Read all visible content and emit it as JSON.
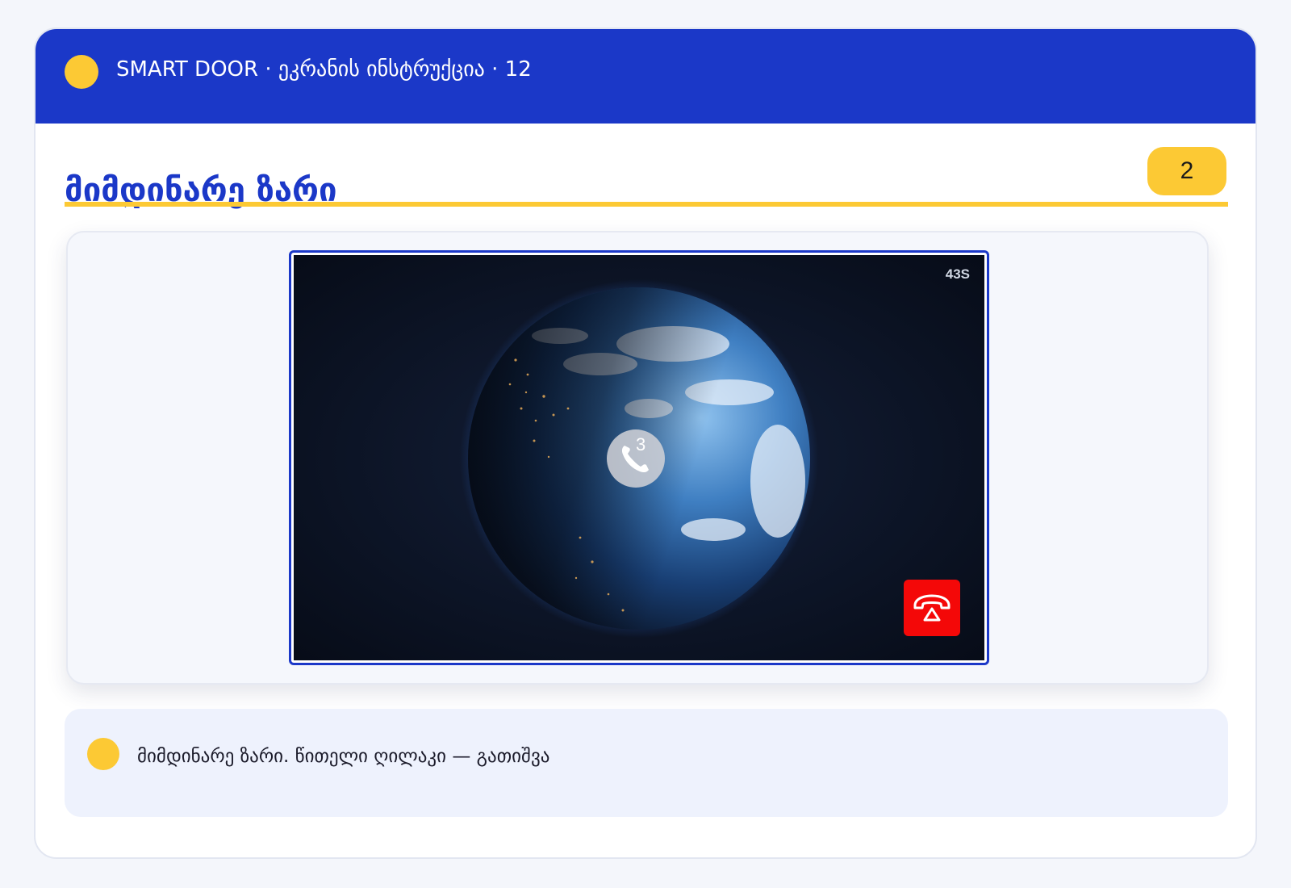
{
  "header": {
    "title": "SMART DOOR · ეკრანის ინსტრუქცია · 12"
  },
  "section": {
    "title": "მიმდინარე ზარი",
    "step_number": "2"
  },
  "screen": {
    "timer": "43S",
    "call_count": "3",
    "icons": [
      "earth-image",
      "phone-call-icon",
      "hangup-phone-icon"
    ],
    "hangup_color": "#f40808"
  },
  "note": {
    "text": "მიმდინარე ზარი. წითელი ღილაკი — გათიშვა"
  },
  "colors": {
    "brand_blue": "#1b38c8",
    "accent_yellow": "#fcc934",
    "background": "#f4f6fb"
  }
}
